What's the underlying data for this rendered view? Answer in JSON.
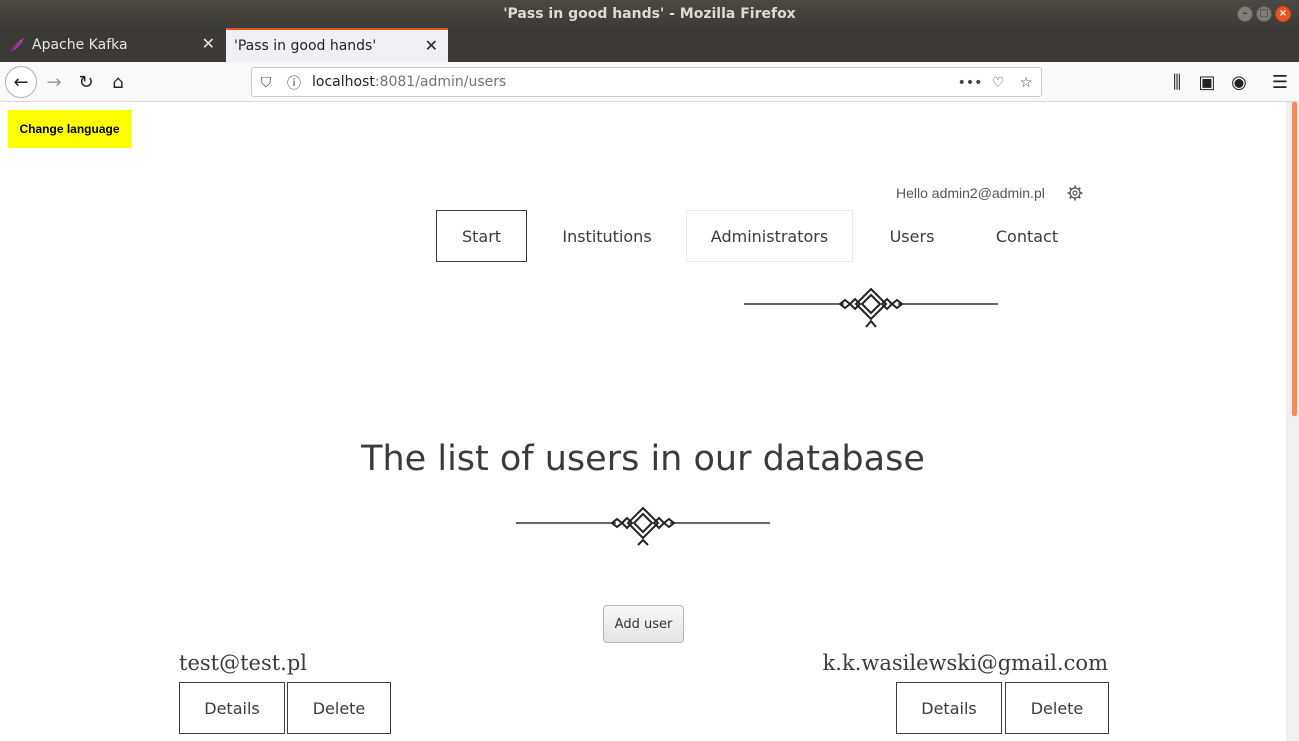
{
  "window": {
    "title": "'Pass in good hands' - Mozilla Firefox"
  },
  "tabs": [
    {
      "label": "Apache Kafka",
      "active": false
    },
    {
      "label": "'Pass in good hands'",
      "active": true
    }
  ],
  "urlbar": {
    "host": "localhost",
    "rest": ":8081/admin/users"
  },
  "page": {
    "change_language": "Change language",
    "greeting": "Hello admin2@admin.pl",
    "menu": {
      "start": "Start",
      "institutions": "Institutions",
      "administrators": "Administrators",
      "users": "Users",
      "contact": "Contact"
    },
    "title": "The list of users in our database",
    "add_user": "Add user",
    "users": [
      {
        "email": "test@test.pl",
        "details": "Details",
        "delete": "Delete"
      },
      {
        "email": "k.k.wasilewski@gmail.com",
        "details": "Details",
        "delete": "Delete"
      }
    ]
  },
  "colors": {
    "accent": "#e95420",
    "language_button": "#ffff00",
    "text": "#3b3b3b"
  }
}
